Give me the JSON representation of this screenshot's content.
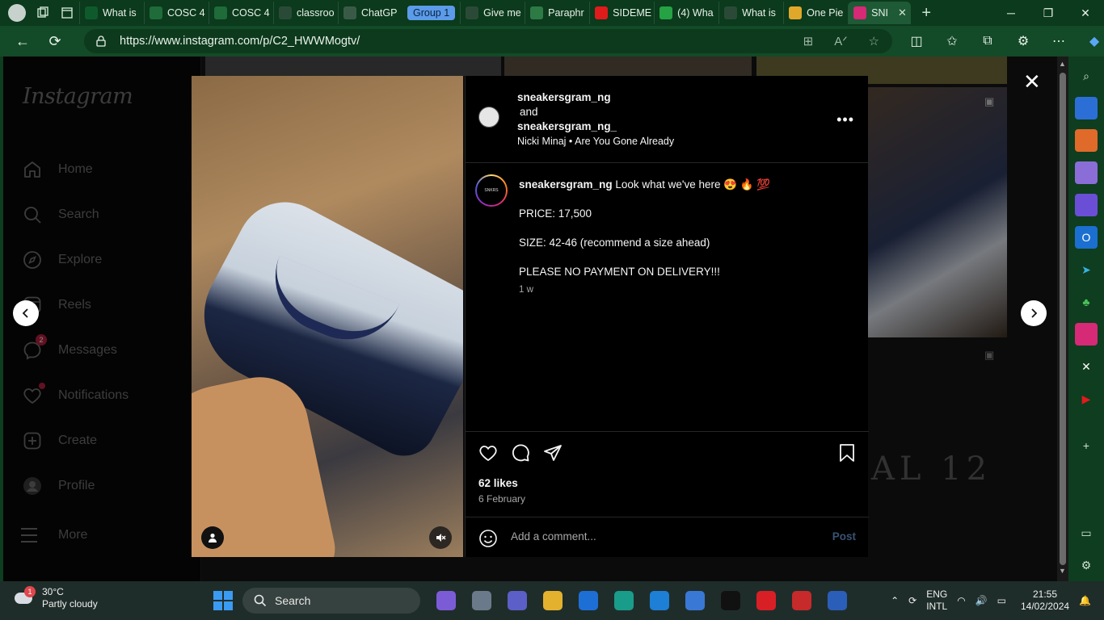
{
  "browser": {
    "tabs": [
      {
        "label": "What is",
        "fav_color": "#0f5a2c"
      },
      {
        "label": "COSC 4",
        "fav_color": "#1f6b3a"
      },
      {
        "label": "COSC 4",
        "fav_color": "#1f6b3a"
      },
      {
        "label": "classroo",
        "fav_color": "#2a4a37"
      },
      {
        "label": "ChatGP",
        "fav_color": "#3a5a48"
      },
      {
        "label": "Give me",
        "fav_color": "#2a4a37"
      },
      {
        "label": "Paraphr",
        "fav_color": "#2e7a45"
      },
      {
        "label": "SIDEME",
        "fav_color": "#e01b1b"
      },
      {
        "label": "(4) Wha",
        "fav_color": "#25a244"
      },
      {
        "label": "What is",
        "fav_color": "#2a4a37"
      },
      {
        "label": "One Pie",
        "fav_color": "#e0a82a"
      },
      {
        "label": "SNI",
        "fav_color": "#d62976"
      }
    ],
    "group_label": "Group 1",
    "url": "https://www.instagram.com/p/C2_HWWMogtv/"
  },
  "instagram": {
    "logo": "Instagram",
    "nav": [
      {
        "label": "Home",
        "icon": "home-icon"
      },
      {
        "label": "Search",
        "icon": "search-icon"
      },
      {
        "label": "Explore",
        "icon": "explore-icon"
      },
      {
        "label": "Reels",
        "icon": "reels-icon"
      },
      {
        "label": "Messages",
        "icon": "messages-icon",
        "badge": "2"
      },
      {
        "label": "Notifications",
        "icon": "heart-icon"
      },
      {
        "label": "Create",
        "icon": "plus-square-icon"
      },
      {
        "label": "Profile",
        "icon": "profile-icon"
      }
    ],
    "more_label": "More",
    "post": {
      "author1": "sneakersgram_ng",
      "and_text": "and",
      "author2": "sneakersgram_ng_",
      "audio_artist": "Nicki Minaj",
      "audio_sep": "•",
      "audio_title": "Are You Gone Already",
      "caption_user": "sneakersgram_ng",
      "caption_text": "Look what we've here 😍 🔥 💯",
      "lines": [
        "PRICE: 17,500",
        "SIZE: 42-46 (recommend a size ahead)",
        "PLEASE NO PAYMENT ON DELIVERY!!!"
      ],
      "time_ago": "1 w",
      "likes": "62 likes",
      "date": "6 February",
      "comment_placeholder": "Add a comment...",
      "post_label": "Post"
    },
    "background_text": "AL 12"
  },
  "taskbar": {
    "weather_temp": "30°C",
    "weather_desc": "Partly cloudy",
    "weather_badge": "1",
    "search_label": "Search",
    "lang": "ENG",
    "lang2": "INTL",
    "time": "21:55",
    "date": "14/02/2024"
  }
}
